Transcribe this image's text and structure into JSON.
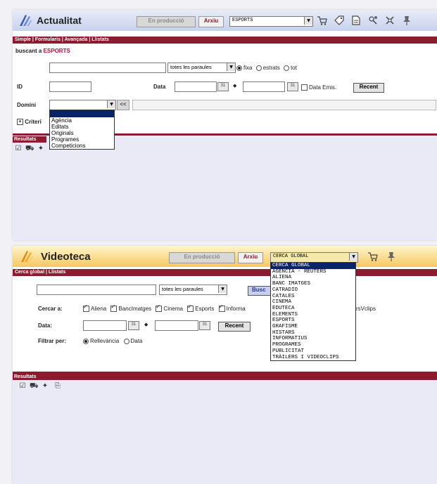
{
  "top": {
    "title": "Actualitat",
    "en_produccio": "En producció",
    "arxiu": "Arxiu",
    "section_select": "ESPORTS",
    "nav": "Simple | Formularis | Avançada | Llistats",
    "buscant_prefix": "buscant a",
    "buscant_target": "ESPORTS",
    "words_select": "totes les paraules",
    "opt_fixa": "fixa",
    "opt_estrats": "estrats",
    "opt_tot": "tot",
    "id_label": "ID",
    "data_label": "Data",
    "cal_label": "31",
    "arrow_sep": "◆",
    "data_emis": "Data Emis.",
    "recent": "Recent",
    "domini_label": "Domini",
    "back_btn": "<<",
    "criteri_label": "Criteri",
    "domini_options": [
      "",
      "Agència",
      "Editats",
      "Originals",
      "Programes",
      "Competicions"
    ],
    "results_label": "Resultats"
  },
  "bottom": {
    "title": "Videoteca",
    "en_produccio": "En producció",
    "arxiu": "Arxiu",
    "section_select": "CERCA GLOBAL",
    "nav": "Cerca global | Llistats",
    "words_select": "totes les paraules",
    "busc": "Busc",
    "cercar_label": "Cercar a:",
    "checks": [
      "Aliena",
      "BancImatges",
      "Cinema",
      "Esports",
      "Informa"
    ],
    "check_tail": "rsVclips",
    "data_label": "Data:",
    "cal_label": "31",
    "arrow_sep": "◆",
    "recent": "Recent",
    "filtrar_label": "Filtrar per:",
    "opt_rellevancia": "Rellevància",
    "opt_data": "Data",
    "results_label": "Resultats",
    "options": [
      "CERCA GLOBAL",
      "AGÈNCIA - REUTERS",
      "ALIENA",
      "BANC IMATGES",
      "CATRADIO",
      "CATALES",
      "CINEMA",
      "EDUTECA",
      "ELEMENTS",
      "ESPORTS",
      "GRAFISME",
      "HISTARS",
      "INFORMATIUS",
      "PROGRAMES",
      "PUBLICITAT",
      "TRÀILERS I VIDEOCLIPS"
    ]
  }
}
